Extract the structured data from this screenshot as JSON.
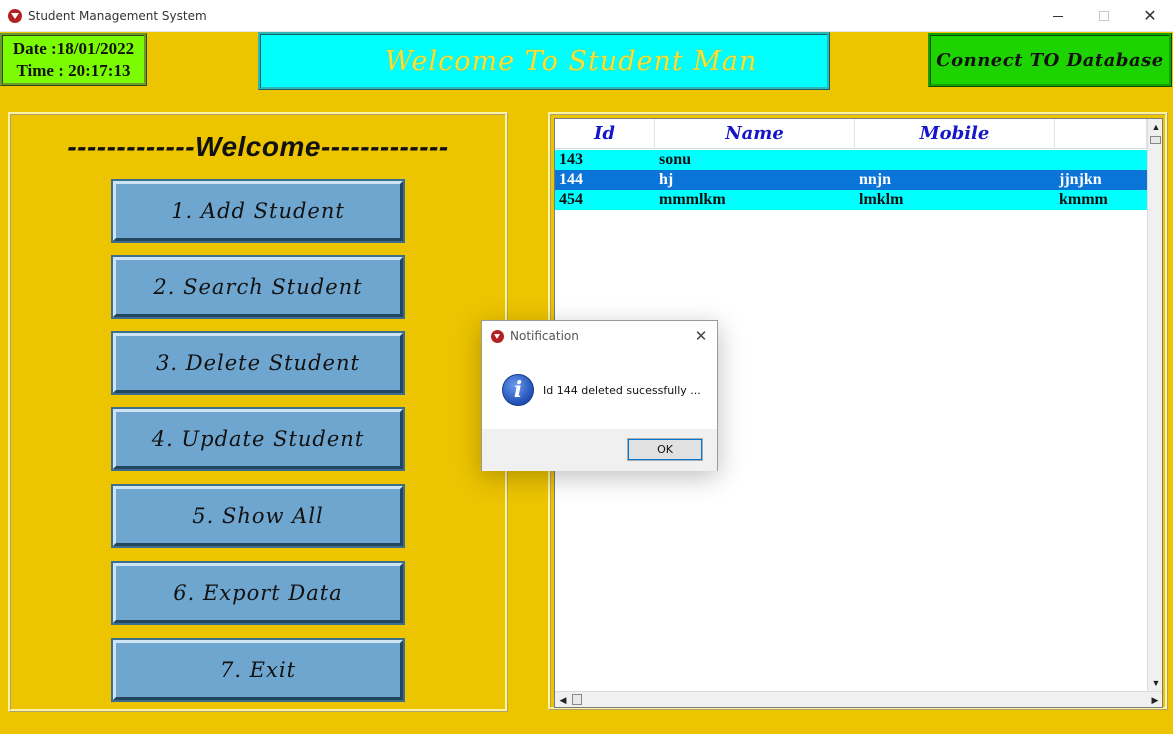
{
  "window": {
    "title": "Student Management System",
    "min_icon": "minimize-icon",
    "max_icon": "maximize-icon",
    "close_icon": "close-icon"
  },
  "header": {
    "date": "Date :18/01/2022",
    "time": "Time : 20:17:13",
    "banner": "Welcome To Student Man",
    "connect_button": "Connect TO Database"
  },
  "menu": {
    "heading": "-------------Welcome-------------",
    "items": [
      {
        "label": "1. Add Student"
      },
      {
        "label": "2. Search Student"
      },
      {
        "label": "3. Delete Student"
      },
      {
        "label": "4. Update Student"
      },
      {
        "label": "5. Show All"
      },
      {
        "label": "6. Export Data"
      },
      {
        "label": "7. Exit"
      }
    ]
  },
  "table": {
    "columns": [
      "Id",
      "Name",
      "Mobile",
      ""
    ],
    "rows": [
      {
        "id": "143",
        "name": "sonu",
        "mobile": "",
        "extra": "",
        "selected": false
      },
      {
        "id": "144",
        "name": "hj",
        "mobile": "nnjn",
        "extra": "jjnjkn",
        "selected": true
      },
      {
        "id": "454",
        "name": "mmmlkm",
        "mobile": "lmklm",
        "extra": "kmmm",
        "selected": false
      }
    ]
  },
  "dialog": {
    "title": "Notification",
    "message": "Id 144 deleted sucessfully ...",
    "ok_label": "OK",
    "info_icon": "i"
  },
  "colors": {
    "background": "#ecc400",
    "datetime_bg": "#7cfc00",
    "banner_bg": "#00ffff",
    "banner_text": "#f5e23a",
    "connect_bg": "#1ed400",
    "menu_button": "#6fa6cf",
    "row_cyan": "#00ffff",
    "row_selected": "#0a74d8",
    "header_text": "#1616c8"
  }
}
